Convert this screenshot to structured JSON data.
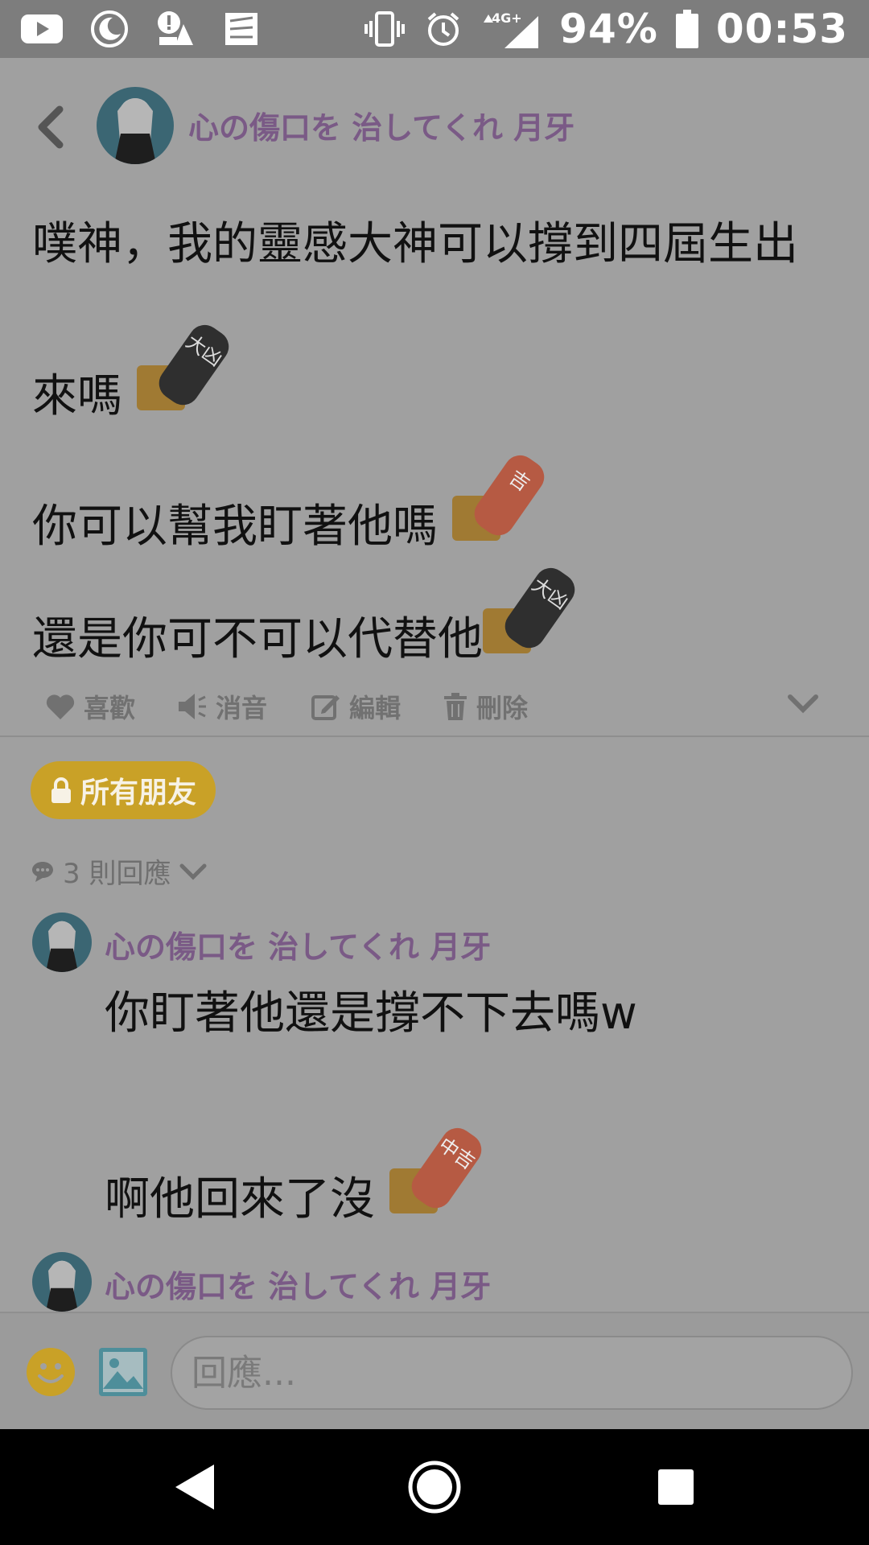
{
  "status_bar": {
    "battery_text": "94%",
    "time": "00:53",
    "network": "4G+",
    "left_icons": [
      "youtube-icon",
      "moon-icon",
      "alert-icon",
      "gallery-icon"
    ],
    "right_icons": [
      "vibrate-icon",
      "alarm-icon",
      "signal-icon",
      "battery-icon"
    ]
  },
  "header": {
    "author_name": "心の傷口を 治してくれ 月牙"
  },
  "post": {
    "lines": [
      "噗神，我的靈感大神可以撐到四屆生出",
      "來嗎",
      "你可以幫我盯著他嗎",
      "還是你可不可以代替他"
    ],
    "stickers": [
      {
        "text": "大凶",
        "color": "#2f2f2f"
      },
      {
        "text": "吉",
        "color": "#b65a43"
      },
      {
        "text": "大凶",
        "color": "#2f2f2f"
      }
    ]
  },
  "actions": {
    "like": "喜歡",
    "mute": "消音",
    "edit": "編輯",
    "delete": "刪除"
  },
  "privacy_badge": "所有朋友",
  "replies": {
    "count_label": "3 則回應",
    "items": [
      {
        "author": "心の傷口を 治してくれ 月牙",
        "lines": [
          "你盯著他還是撐不下去嗎w",
          "啊他回來了沒"
        ],
        "sticker": {
          "text": "中吉",
          "color": "#b65a43"
        }
      },
      {
        "author": "心の傷口を 治してくれ 月牙"
      }
    ]
  },
  "reply_input": {
    "placeholder": "回應..."
  },
  "colors": {
    "name": "#7a5a86",
    "badge": "#c9a127",
    "emoji": "#c9a127",
    "image_icon": "#4e8e9a"
  }
}
